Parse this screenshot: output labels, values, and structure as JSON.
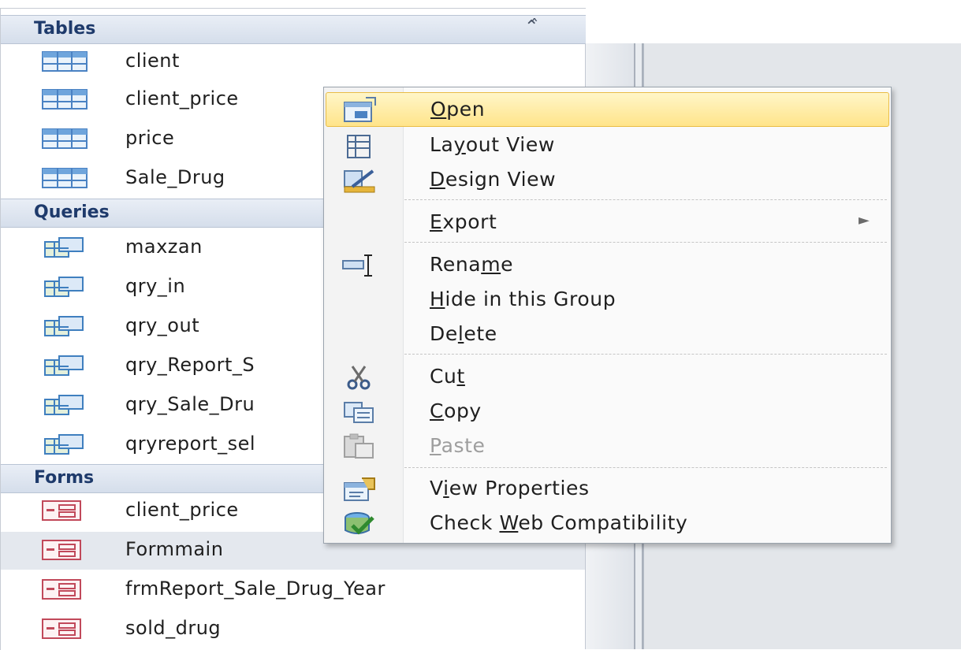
{
  "nav": {
    "groups": [
      {
        "title": "Tables",
        "collapse_icon": "chevron-double-up-icon",
        "items": [
          {
            "label": "client",
            "icon": "table-icon"
          },
          {
            "label": "client_price",
            "icon": "table-icon"
          },
          {
            "label": "price",
            "icon": "table-icon"
          },
          {
            "label": "Sale_Drug",
            "icon": "table-icon"
          }
        ]
      },
      {
        "title": "Queries",
        "items": [
          {
            "label": "maxzan",
            "icon": "query-icon"
          },
          {
            "label": "qry_in",
            "icon": "query-icon"
          },
          {
            "label": "qry_out",
            "icon": "query-icon"
          },
          {
            "label": "qry_Report_S",
            "icon": "query-icon"
          },
          {
            "label": "qry_Sale_Dru",
            "icon": "query-icon"
          },
          {
            "label": "qryreport_sel",
            "icon": "query-icon"
          }
        ]
      },
      {
        "title": "Forms",
        "items": [
          {
            "label": "client_price",
            "icon": "form-icon"
          },
          {
            "label": "Formmain",
            "icon": "form-icon",
            "selected": true
          },
          {
            "label": "frmReport_Sale_Drug_Year",
            "icon": "form-icon"
          },
          {
            "label": "sold_drug",
            "icon": "form-icon"
          }
        ]
      }
    ]
  },
  "context_menu": {
    "items": [
      {
        "pre": "",
        "key": "O",
        "post": "pen",
        "icon": "open-form-icon",
        "highlighted": true
      },
      {
        "pre": "La",
        "key": "y",
        "post": "out View",
        "icon": "layout-view-icon"
      },
      {
        "pre": "",
        "key": "D",
        "post": "esign View",
        "icon": "design-view-icon"
      },
      {
        "pre": "",
        "key": "E",
        "post": "xport",
        "submenu": true
      },
      {
        "pre": "Rena",
        "key": "m",
        "post": "e",
        "icon": "rename-icon"
      },
      {
        "pre": "",
        "key": "H",
        "post": "ide in this Group"
      },
      {
        "pre": "De",
        "key": "l",
        "post": "ete"
      },
      {
        "pre": "Cu",
        "key": "t",
        "post": "",
        "icon": "scissors-icon"
      },
      {
        "pre": "",
        "key": "C",
        "post": "opy",
        "icon": "copy-icon"
      },
      {
        "pre": "",
        "key": "P",
        "post": "aste",
        "icon": "paste-icon",
        "disabled": true
      },
      {
        "pre": "V",
        "key": "i",
        "post": "ew Properties",
        "icon": "properties-icon"
      },
      {
        "pre": "Check ",
        "key": "W",
        "post": "eb Compatibility",
        "icon": "web-compatibility-icon"
      }
    ]
  }
}
